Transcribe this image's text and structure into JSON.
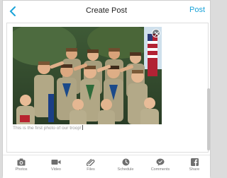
{
  "header": {
    "title": "Create Post",
    "post_label": "Post"
  },
  "composer": {
    "caption": "This is the first photo of our troop!",
    "photo_alt": "Scouts saluting in uniform"
  },
  "toolbar": {
    "items": [
      {
        "label": "Photos",
        "icon": "camera-icon"
      },
      {
        "label": "Video",
        "icon": "video-camera-icon"
      },
      {
        "label": "Files",
        "icon": "paperclip-icon"
      },
      {
        "label": "Schedule",
        "icon": "clock-icon"
      },
      {
        "label": "Comments",
        "icon": "chat-bubble-icon"
      },
      {
        "label": "Share",
        "icon": "facebook-icon"
      }
    ]
  },
  "colors": {
    "accent": "#1aa3d9",
    "icon_gray": "#6f6f6f"
  }
}
